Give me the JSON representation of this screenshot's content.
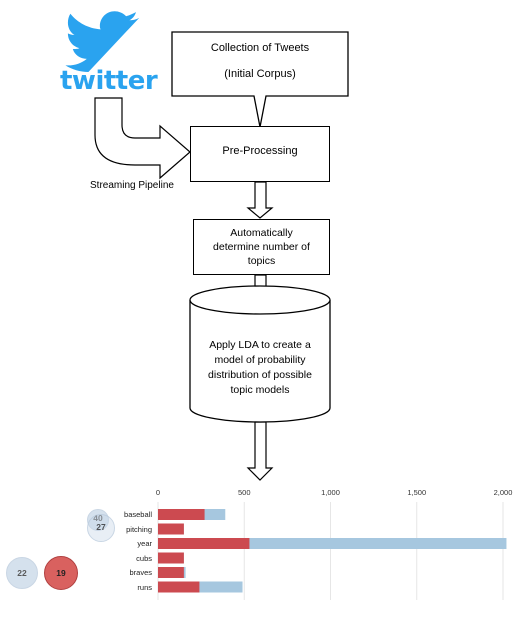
{
  "logo": {
    "wordmark": "twitter",
    "icon": "twitter-bird-icon",
    "color": "#2aa3ef"
  },
  "nodes": {
    "collection": {
      "line1": "Collection of Tweets",
      "line2": "(Initial Corpus)"
    },
    "preprocessing": {
      "label": "Pre-Processing"
    },
    "determine": {
      "line1": "Automatically",
      "line2": "determine number of",
      "line3": "topics"
    },
    "lda": {
      "line1": "Apply LDA to create a",
      "line2": "model of probability",
      "line3": "distribution of possible",
      "line4": "topic models"
    }
  },
  "streaming_label": "Streaming Pipeline",
  "chart_data": {
    "type": "bar",
    "categories": [
      "baseball",
      "pitching",
      "year",
      "cubs",
      "braves",
      "runs"
    ],
    "series": [
      {
        "values": [
          270,
          150,
          530,
          150,
          150,
          240
        ],
        "color": "#cc4a50"
      },
      {
        "values": [
          390,
          150,
          2020,
          150,
          160,
          490
        ],
        "color": "#a6c7df"
      }
    ],
    "xticks": [
      "0",
      "500",
      "1,000",
      "1,500",
      "2,000"
    ],
    "xlim": [
      0,
      2000
    ],
    "bubbles": [
      {
        "label": "40",
        "color": "#c7d7e8"
      },
      {
        "label": "27",
        "color": "#c7d7e8"
      },
      {
        "label": "22",
        "color": "#c7d7e8"
      },
      {
        "label": "19",
        "color": "#d9615f"
      }
    ]
  }
}
